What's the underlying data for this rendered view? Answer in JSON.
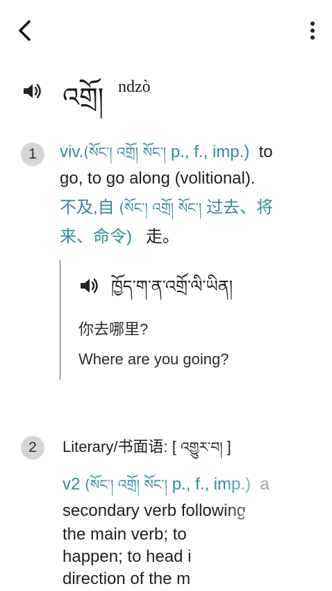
{
  "entry": {
    "headword": "འགྲོ།",
    "pronunciation": "ndzò"
  },
  "senses": [
    {
      "number": "1",
      "pos": "viv.",
      "tib_forms": "(སོང་། འགྲོ། སོང་།",
      "pfi": "p., f., imp.)",
      "definition_en_1": "to",
      "definition_en_2": "go, to go along (volitional).",
      "pos_zh": "不及,自",
      "tib_forms_zh": "(སོང་། འགྲོ། སོང་།",
      "tense_zh_1": "过去、将",
      "tense_zh_2": "来、命令)",
      "definition_zh": "走。",
      "example": {
        "tibetan": "ཁྱོད་ག་ན་འགྲོ་ལི་ཡིན།",
        "zh": "你去哪里?",
        "en": "Where are you going?"
      }
    },
    {
      "number": "2",
      "register": "Literary/书面语: [",
      "register_tib": "འགྱུར་བ།",
      "register_close": "]",
      "pos": "v2",
      "tib_forms": "(སོང་། འགྲོ། སོང་།",
      "pfi": "p., f., imp.)",
      "definition_en_1": "a",
      "definition_en_2": "secondary verb following",
      "definition_en_3": "the main verb; to",
      "definition_en_4": "happen; to head i",
      "definition_en_5": "direction of the m"
    }
  ],
  "icons": {
    "back": "chevron-left-icon",
    "more": "more-vertical-icon",
    "speaker": "speaker-icon"
  }
}
